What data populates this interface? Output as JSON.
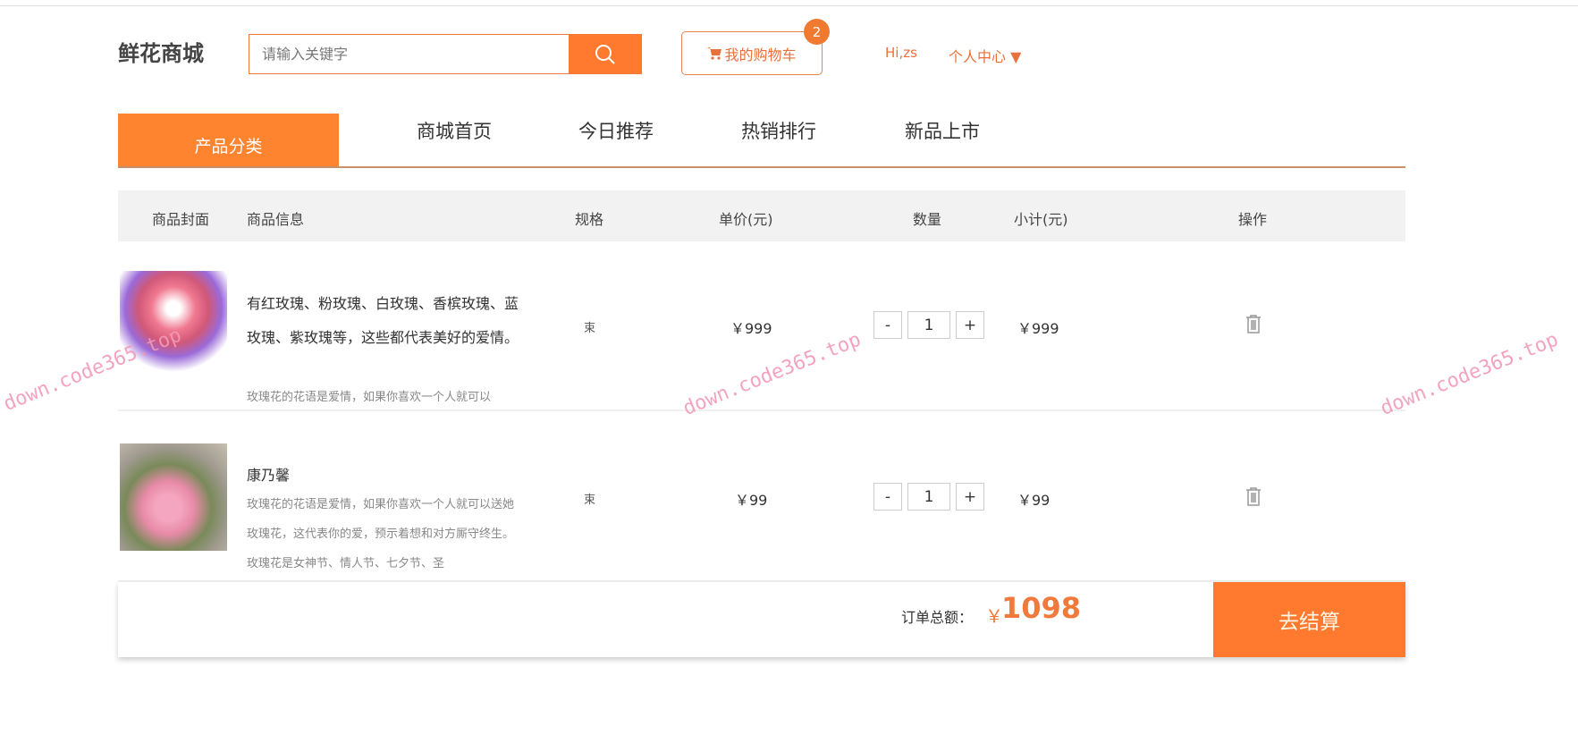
{
  "header": {
    "logo": "鲜花商城",
    "search_placeholder": "请输入关键字",
    "cart_label": "我的购物车",
    "cart_count": "2",
    "greeting": "Hi,zs",
    "user_center": "个人中心 ▼"
  },
  "nav": {
    "category": "产品分类",
    "items": [
      "商城首页",
      "今日推荐",
      "热销排行",
      "新品上市"
    ]
  },
  "table": {
    "headers": [
      "商品封面",
      "商品信息",
      "规格",
      "单价(元)",
      "数量",
      "小计(元)",
      "操作"
    ],
    "rows": [
      {
        "title": "有红玫瑰、粉玫瑰、白玫瑰、香槟玫瑰、蓝玫瑰、紫玫瑰等，这些都代表美好的爱情。",
        "desc": "玫瑰花的花语是爱情，如果你喜欢一个人就可以",
        "spec": "束",
        "price": "￥999",
        "qty": "1",
        "subtotal": "￥999"
      },
      {
        "title": "康乃馨",
        "desc": "玫瑰花的花语是爱情，如果你喜欢一个人就可以送她玫瑰花，这代表你的爱，预示着想和对方厮守终生。玫瑰花是女神节、情人节、七夕节、圣",
        "spec": "束",
        "price": "￥99",
        "qty": "1",
        "subtotal": "￥99"
      }
    ],
    "minus": "-",
    "plus": "+"
  },
  "footer": {
    "total_label": "订单总额：",
    "currency": "￥",
    "total": "1098",
    "checkout": "去结算"
  },
  "watermark": "down.code365.top",
  "colors": {
    "accent": "#ff7a2f"
  }
}
